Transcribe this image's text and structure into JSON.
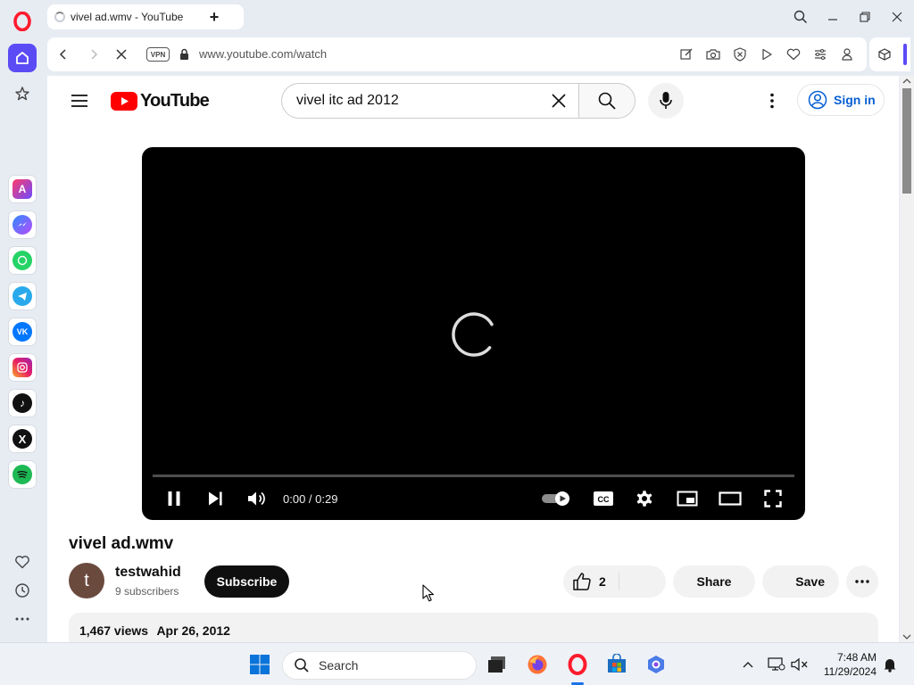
{
  "browser": {
    "tab_title": "vivel ad.wmv - YouTube",
    "url": "www.youtube.com/watch",
    "vpn_label": "VPN"
  },
  "youtube": {
    "logo_text": "YouTube",
    "search_query": "vivel itc ad 2012",
    "sign_in_label": "Sign in",
    "player": {
      "time": "0:00 / 0:29"
    },
    "video": {
      "title": "vivel ad.wmv",
      "channel_avatar_letter": "t",
      "channel_name": "testwahid",
      "subscribers": "9 subscribers",
      "subscribe_label": "Subscribe",
      "likes": "2",
      "share_label": "Share",
      "save_label": "Save",
      "views": "1,467 views",
      "date": "Apr 26, 2012"
    }
  },
  "taskbar": {
    "search_placeholder": "Search",
    "time": "7:48 AM",
    "date": "11/29/2024"
  },
  "colors": {
    "opera_red": "#ff1b2d",
    "youtube_red": "#ff0000",
    "link_blue": "#065fd4",
    "opera_home_purple": "#5b4bf5"
  }
}
